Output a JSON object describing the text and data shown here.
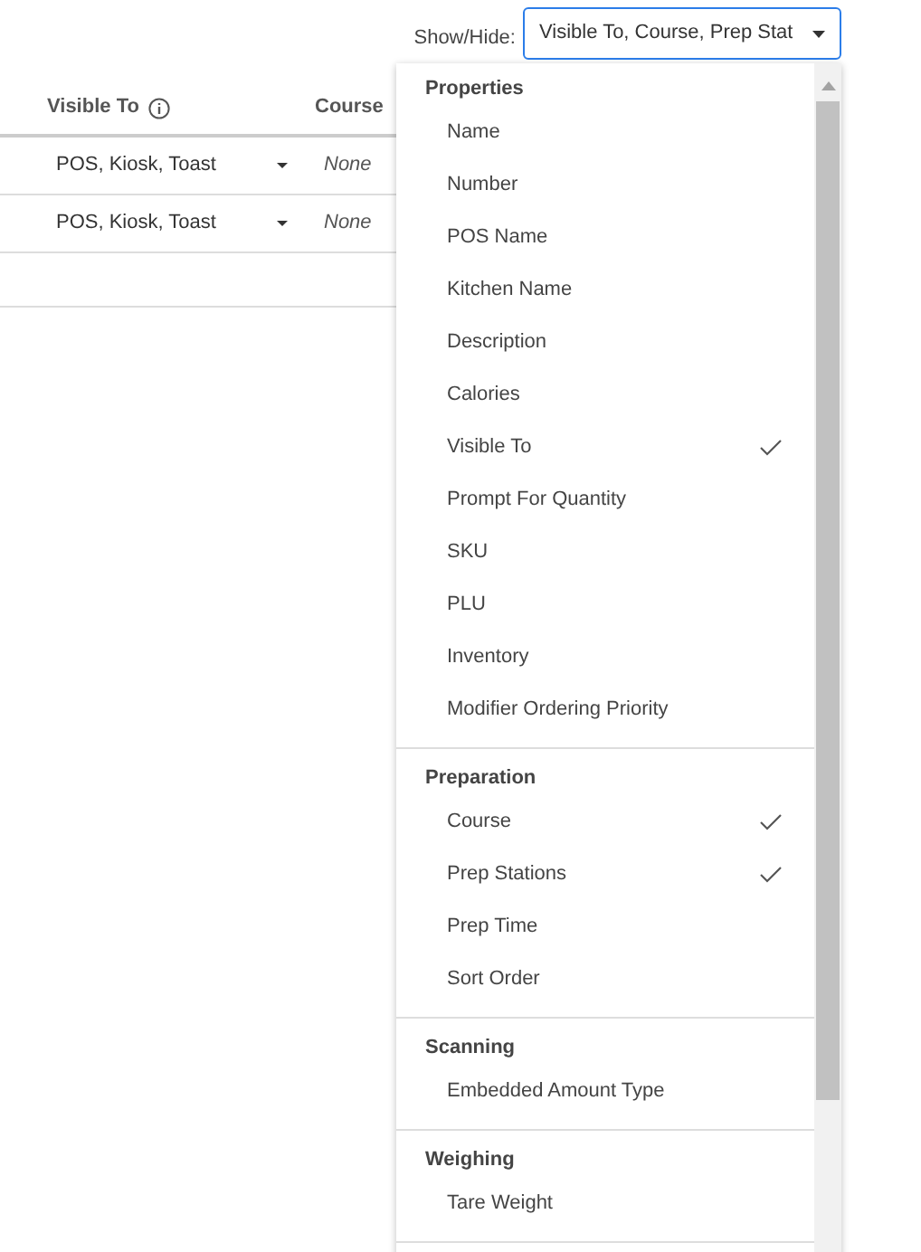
{
  "show_hide": {
    "label": "Show/Hide:",
    "value": "Visible To, Course, Prep Stat"
  },
  "table": {
    "columns": [
      {
        "label": "Visible To",
        "info": true
      },
      {
        "label": "Course",
        "info": false
      }
    ],
    "rows": [
      {
        "visible_to": "POS, Kiosk, Toast",
        "course": "None"
      },
      {
        "visible_to": "POS, Kiosk, Toast",
        "course": "None"
      }
    ]
  },
  "menu": {
    "sections": [
      {
        "title": "Properties",
        "items": [
          {
            "label": "Name",
            "checked": false
          },
          {
            "label": "Number",
            "checked": false
          },
          {
            "label": "POS Name",
            "checked": false
          },
          {
            "label": "Kitchen Name",
            "checked": false
          },
          {
            "label": "Description",
            "checked": false
          },
          {
            "label": "Calories",
            "checked": false
          },
          {
            "label": "Visible To",
            "checked": true
          },
          {
            "label": "Prompt For Quantity",
            "checked": false
          },
          {
            "label": "SKU",
            "checked": false
          },
          {
            "label": "PLU",
            "checked": false
          },
          {
            "label": "Inventory",
            "checked": false
          },
          {
            "label": "Modifier Ordering Priority",
            "checked": false
          }
        ]
      },
      {
        "title": "Preparation",
        "items": [
          {
            "label": "Course",
            "checked": true
          },
          {
            "label": "Prep Stations",
            "checked": true
          },
          {
            "label": "Prep Time",
            "checked": false
          },
          {
            "label": "Sort Order",
            "checked": false
          }
        ]
      },
      {
        "title": "Scanning",
        "items": [
          {
            "label": "Embedded Amount Type",
            "checked": false
          }
        ]
      },
      {
        "title": "Weighing",
        "items": [
          {
            "label": "Tare Weight",
            "checked": false
          }
        ]
      }
    ]
  }
}
